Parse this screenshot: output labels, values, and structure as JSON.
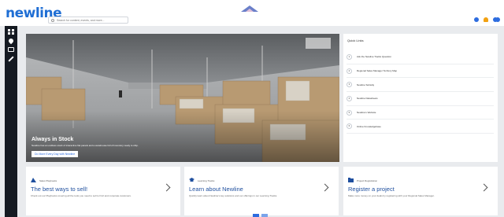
{
  "header": {
    "logo": "newline",
    "search_placeholder": "Search for content, events, and more..."
  },
  "hero": {
    "title": "Always in Stock",
    "subtitle": "Newline has an endless stock of interactive flat panels and a warehouse full of inventory ready to ship.",
    "button": "Do More Every Day with Newline"
  },
  "quick_links": {
    "title": "Quick Links",
    "items": [
      {
        "num": "1",
        "label": "Ask the Newline Tracks Question"
      },
      {
        "num": "2",
        "label": "Regional Sales Manager Territory Map"
      },
      {
        "num": "3",
        "label": "Newline Subsidy"
      },
      {
        "num": "4",
        "label": "Newline Datasheets"
      },
      {
        "num": "5",
        "label": "Newline's Website"
      },
      {
        "num": "6",
        "label": "Online Knowledgebase"
      }
    ]
  },
  "cards": [
    {
      "category": "Sales Playbooks",
      "title": "The best ways to sell!",
      "desc": "Check out our Playbooks covering all the tools you need to sell to K12 and corporate customers."
    },
    {
      "category": "Learning Tracks",
      "title": "Learn about Newline",
      "desc": "Quickly learn about Newline's key solutions and our offerings in our Learning Tracks."
    },
    {
      "category": "Project Registration",
      "title": "Register a project",
      "desc": "Make more money on your deals by registering with your Regional Sales Manager."
    }
  ],
  "colors": {
    "accent": "#2d6cdf",
    "title_blue": "#1f4f9e",
    "sidebar": "#151a22"
  }
}
